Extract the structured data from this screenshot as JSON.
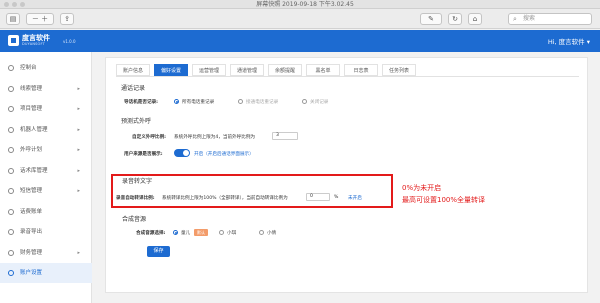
{
  "window": {
    "title": "屏幕快照 2019-09-18 下午3.02.45"
  },
  "toolbar": {
    "search_placeholder": "搜索"
  },
  "header": {
    "brand": "度言软件",
    "brand_sub": "DUYANSOFT",
    "version": "v1.0.0",
    "user": "Hi, 度言软件 ▾",
    "brand_color": "#1d6bd1"
  },
  "sidebar": {
    "items": [
      {
        "label": "控制台",
        "icon": "dashboard-icon",
        "arrow": ""
      },
      {
        "label": "线索管理",
        "icon": "list-icon",
        "arrow": "▸"
      },
      {
        "label": "项目管理",
        "icon": "folder-icon",
        "arrow": "▸"
      },
      {
        "label": "机器人管理",
        "icon": "robot-icon",
        "arrow": "▸"
      },
      {
        "label": "外呼计划",
        "icon": "phone-icon",
        "arrow": "▸"
      },
      {
        "label": "话术库管理",
        "icon": "book-icon",
        "arrow": "▸"
      },
      {
        "label": "短信管理",
        "icon": "message-icon",
        "arrow": "▸"
      },
      {
        "label": "话费账单",
        "icon": "bill-icon",
        "arrow": ""
      },
      {
        "label": "录音导出",
        "icon": "record-icon",
        "arrow": ""
      },
      {
        "label": "财务管理",
        "icon": "finance-icon",
        "arrow": "▸"
      },
      {
        "label": "账户设置",
        "icon": "settings-icon",
        "arrow": ""
      }
    ],
    "active_index": 10
  },
  "tabs": [
    "账户信息",
    "偏好设置",
    "运营管理",
    "通道管理",
    "余额提醒",
    "黑名单",
    "日志表",
    "任务列表"
  ],
  "active_tab": 1,
  "call_record": {
    "section": "通话记录",
    "label": "导话机是否记录:",
    "options": [
      "所有电话重记录",
      "接通电话重记录",
      "关闭记录"
    ],
    "selected": 0
  },
  "predictive": {
    "section": "预测式外呼",
    "ratio_label": "自定义外呼比例:",
    "ratio_text": "系统外呼比例上限为4，当前外呼比例为",
    "ratio_value": "3",
    "reveal_label": "用户来源是否展示:",
    "reveal_text": "开启（开启后通话界面展示）",
    "reveal_on": true
  },
  "transcribe": {
    "section": "录音转文字",
    "label": "录音自动转译比例:",
    "text": "系统转译比例上限为100%（全部转译），当前自动转译比例为",
    "value": "0",
    "unit": "%",
    "status": "未开启"
  },
  "annotation": {
    "line1": "0%为未开启",
    "line2": "最高可设置100%全量转译",
    "color": "#e31a1a"
  },
  "tts": {
    "section": "合成音源",
    "label": "合成音源选择:",
    "options": [
      "童儿",
      "小琪",
      "小倩"
    ],
    "tag": "默认",
    "selected": 0
  },
  "save_label": "保存"
}
